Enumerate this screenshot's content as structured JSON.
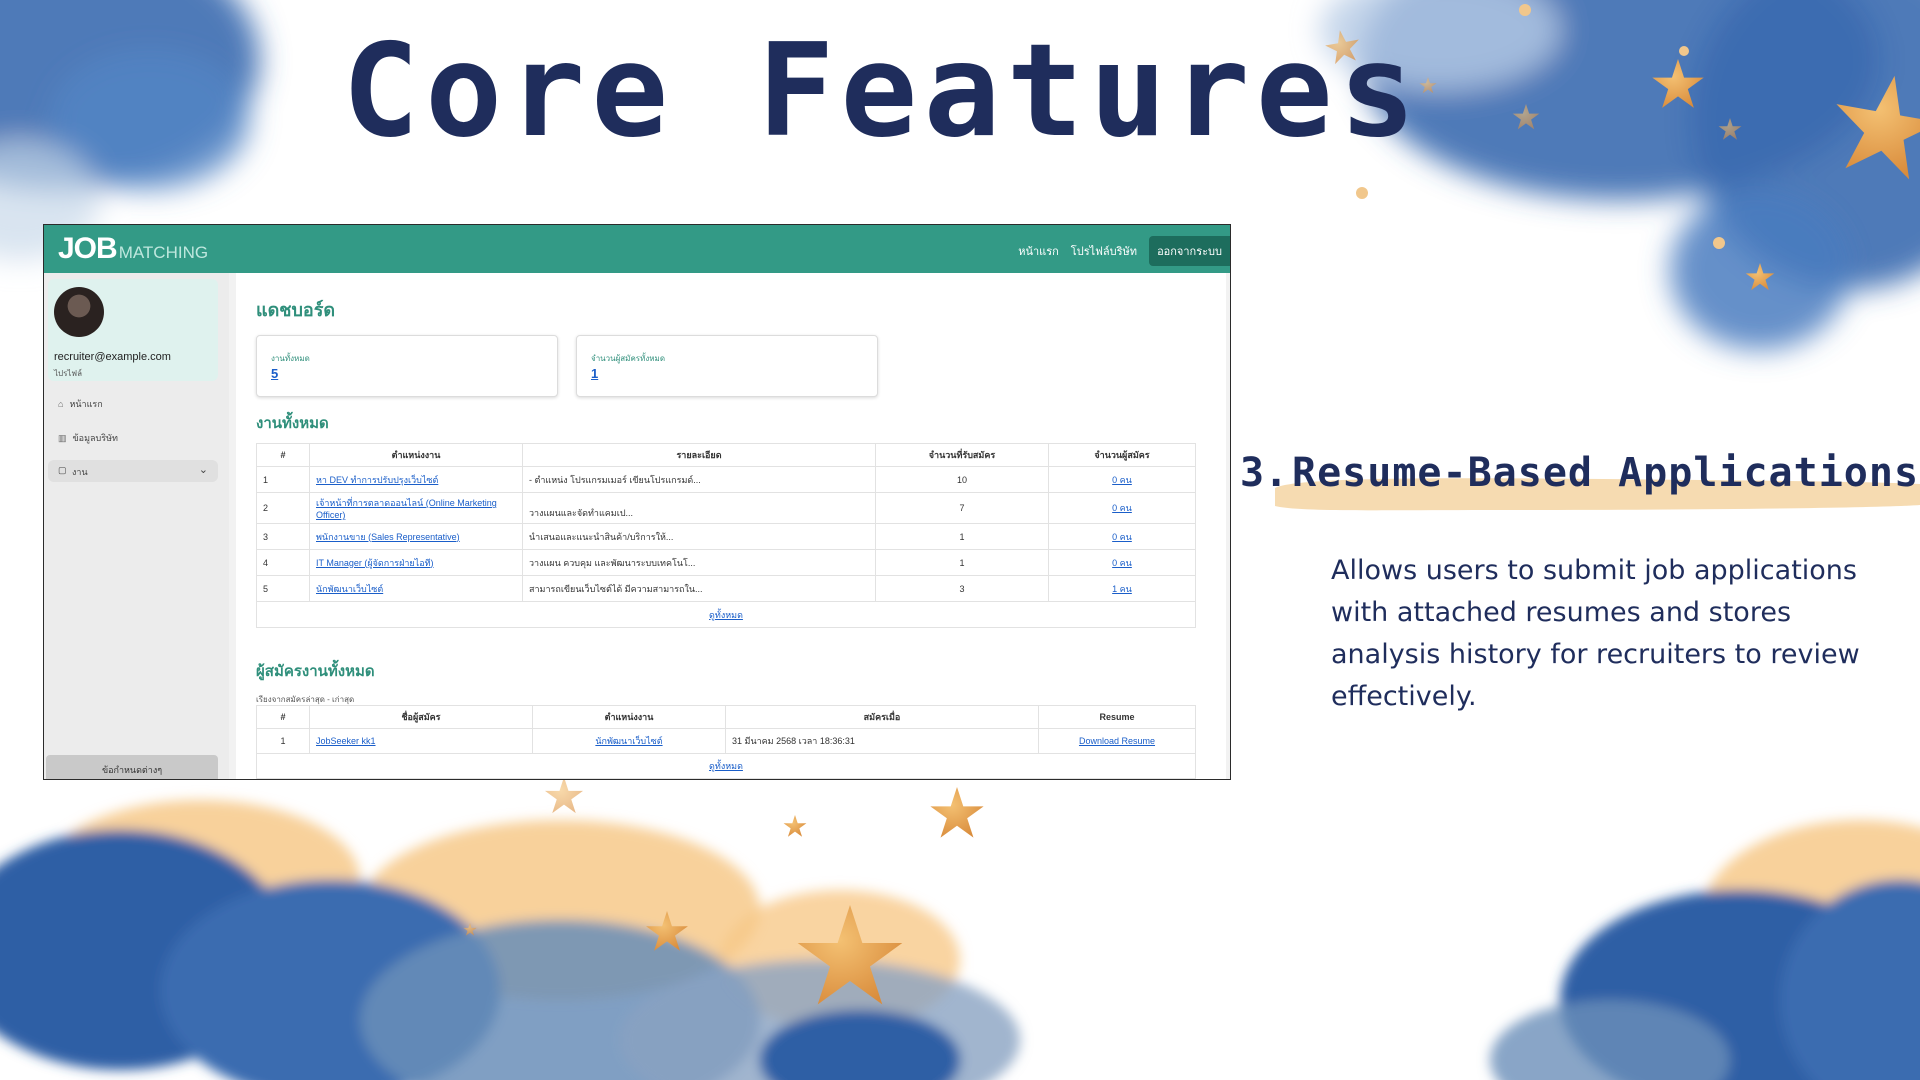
{
  "slide": {
    "title": "Core Features",
    "feature_number": "3.",
    "feature_title": "Resume-Based Applications",
    "description": "Allows users to submit job applications with attached resumes and stores analysis history for recruiters to review effectively."
  },
  "app": {
    "logo_main": "JOB",
    "logo_sub": "MATCHING",
    "nav": {
      "home": "หน้าแรก",
      "profile": "โปรไฟล์บริษัท",
      "logout": "ออกจากระบบ"
    },
    "sidebar": {
      "email": "recruiter@example.com",
      "role": "ไปรไฟล์",
      "items": [
        {
          "icon": "home-icon",
          "label": "หน้าแรก"
        },
        {
          "icon": "chart-icon",
          "label": "ข้อมูลบริษัท"
        }
      ],
      "dropdown": {
        "icon": "briefcase-icon",
        "label": "งาน"
      },
      "footer": "ข้อกำหนดต่างๆ"
    },
    "dashboard": {
      "title": "แดชบอร์ด",
      "stats": [
        {
          "label": "งานทั้งหมด",
          "value": "5"
        },
        {
          "label": "จำนวนผู้สมัครทั้งหมด",
          "value": "1"
        }
      ],
      "jobs_title": "งานทั้งหมด",
      "jobs_headers": [
        "#",
        "ตำแหน่งงาน",
        "รายละเอียด",
        "จำนวนที่รับสมัคร",
        "จำนวนผู้สมัคร"
      ],
      "jobs_rows": [
        [
          "1",
          "หา DEV ทำการปรับปรุงเว็บไซต์",
          "- ตำแหน่ง โปรแกรมเมอร์ เขียนโปรแกรมด์...",
          "10",
          "0 คน"
        ],
        [
          "2",
          "เจ้าหน้าที่การตลาดออนไลน์ (Online Marketing Officer)",
          "วางแผนและจัดทำแคมเป...",
          "7",
          "0 คน"
        ],
        [
          "3",
          "พนักงานขาย (Sales Representative)",
          "นำเสนอและแนะนำสินค้า/บริการให้...",
          "1",
          "0 คน"
        ],
        [
          "4",
          "IT Manager (ผู้จัดการฝ่ายไอที)",
          "วางแผน ควบคุม และพัฒนาระบบเทคโนโ...",
          "1",
          "0 คน"
        ],
        [
          "5",
          "นักพัฒนาเว็บไซต์",
          "สามารถเขียนเว็บไซต์ได้ มีความสามารถใน...",
          "3",
          "1 คน"
        ]
      ],
      "view_all": "ดูทั้งหมด",
      "applicants_title": "ผู้สมัครงานทั้งหมด",
      "applicants_note": "เรียงจากสมัครล่าสุด - เก่าสุด",
      "applicants_headers": [
        "#",
        "ชื่อผู้สมัคร",
        "ตำแหน่งงาน",
        "สมัครเมื่อ",
        "Resume"
      ],
      "applicants_rows": [
        [
          "1",
          "JobSeeker kk1",
          "นักพัฒนาเว็บไซต์",
          "31 มีนาคม 2568 เวลา 18:36:31",
          "Download Resume"
        ]
      ]
    }
  }
}
